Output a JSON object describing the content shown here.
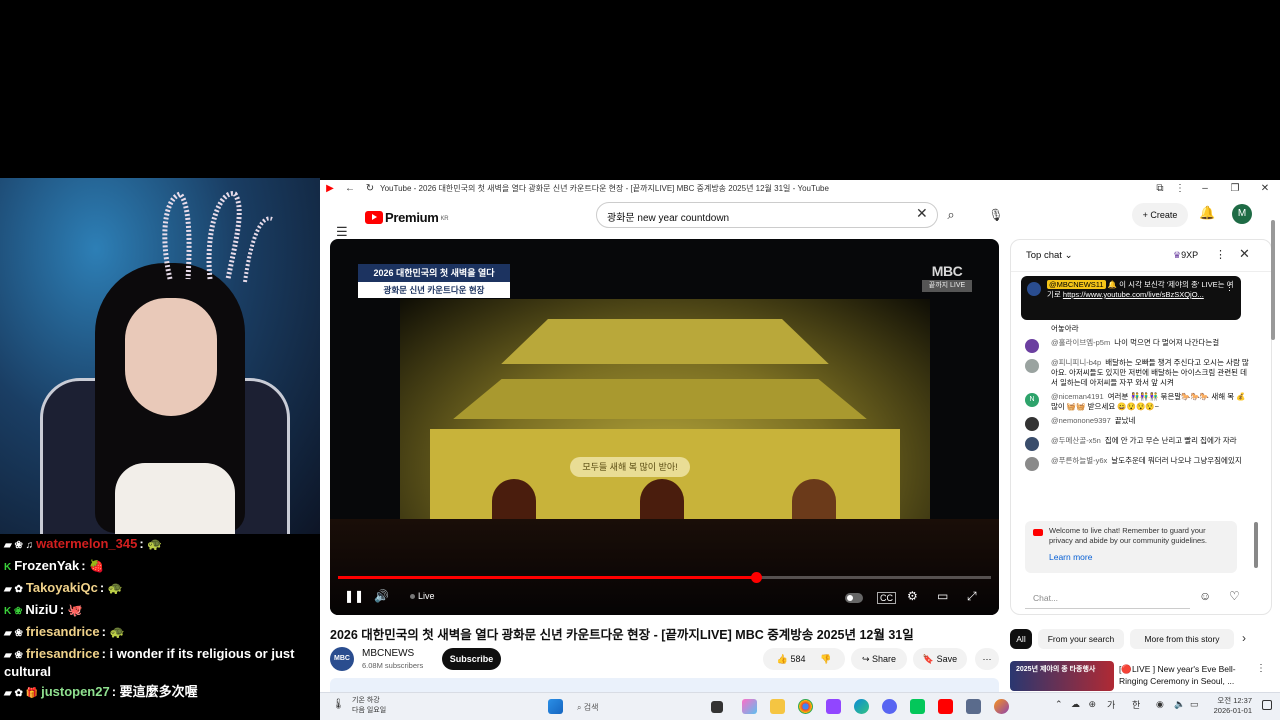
{
  "stream_chat": [
    {
      "badges": "▰ ❀ ♫",
      "user": "watermelon_345",
      "color": "#d21f1f",
      "sep": ":",
      "text": "",
      "emote": "🐢"
    },
    {
      "badges": "K",
      "user": "FrozenYak",
      "color": "#ffffff",
      "sep": ":",
      "text": "",
      "emote": "🍓"
    },
    {
      "badges": "▰ ✿",
      "user": "TakoyakiQc",
      "color": "#f0d28a",
      "sep": ":",
      "text": "",
      "emote": "🐢"
    },
    {
      "badges": "K ❀",
      "user": "NiziU",
      "color": "#ffffff",
      "sep": ":",
      "text": "",
      "emote": "🐙"
    },
    {
      "badges": "▰ ❀",
      "user": "friesandrice",
      "color": "#f0d28a",
      "sep": ":",
      "text": "",
      "emote": "🐢"
    },
    {
      "badges": "▰ ❀",
      "user": "friesandrice",
      "color": "#f0d28a",
      "sep": ":",
      "text": "i wonder if its religious or just cultural",
      "emote": ""
    },
    {
      "badges": "▰ ✿ 🎁",
      "user": "justopen27",
      "color": "#8fe08f",
      "sep": ":",
      "text": "要這麼多次喔",
      "emote": ""
    }
  ],
  "browser": {
    "window_title": "YouTube - 2026 대한민국의 첫 새벽을 열다 광화문 신년 카운트다운 현장 - [끝까지LIVE] MBC 중계방송 2025년 12월 31일 - YouTube",
    "brand": "Premium",
    "brand_region": "KR",
    "search_value": "광화문 new year countdown",
    "create_label": "Create",
    "avatar_letter": "M"
  },
  "player": {
    "caption_line1": "2026 대한민국의 첫 새벽을 열다",
    "caption_line2": "광화문 신년 카운트다운 현장",
    "logo": "MBC",
    "logo_sub": "끝까지 LIVE",
    "banner_text": "모두들 새해 복 많이 받아!",
    "live_label": "Live",
    "progress": 0.64
  },
  "video": {
    "title": "2026 대한민국의 첫 새벽을 열다 광화문 신년 카운트다운 현장 - [끝까지LIVE] MBC 중계방송 2025년 12월 31일",
    "channel": "MBCNEWS",
    "channel_avatar": "MBC NEWS",
    "subscribers": "6.08M subscribers",
    "subscribe_label": "Subscribe",
    "likes": "584",
    "share_label": "Share",
    "save_label": "Save"
  },
  "live_chat": {
    "header": "Top chat",
    "xp": "9XP",
    "pinned": {
      "tag": "@MBCNEWS11",
      "text": "🔔 이 시각 보신각 '제야의 종' LIVE는 여기로",
      "link": "https://www.youtube.com/live/sBzSXQjO..."
    },
    "messages": [
      {
        "author": "",
        "text": "어놓아라",
        "av_color": "#ffffff",
        "av_letter": ""
      },
      {
        "author": "@홀라이브엠-p5m",
        "text": "나이 먹으면 다 멀어져 나간다는걸",
        "av_color": "#6b3fa0",
        "av_letter": ""
      },
      {
        "author": "@피니피니-b4p",
        "text": "배달하는 오빠들 챙겨 주신다고 오시는 사람 많아요. 아저씨들도 있지만 저번에 배달하는 아이스크림 관련된 데서 일하는데 아저씨들 자꾸 와서 앞 시켜",
        "av_color": "#9aa3a0",
        "av_letter": ""
      },
      {
        "author": "@niceman4191",
        "text": "여러분 👫👫👫 묶은말🐎🐎🐎 새해 복 💰 많이 🧺🧺 받으세요 😀😯😯😯~",
        "av_color": "#2ea36b",
        "av_letter": "N"
      },
      {
        "author": "@nemonone9397",
        "text": "끝났네",
        "av_color": "#333333",
        "av_letter": ""
      },
      {
        "author": "@두메산골-x5n",
        "text": "집에 안 가고 무슨 난리고 빨리 집에가 자라",
        "av_color": "#3a4d6b",
        "av_letter": ""
      },
      {
        "author": "@푸른하늘별-y6x",
        "text": "날도추운데 뭐더러 나오냐 그냥우짐에있지",
        "av_color": "#8a8a8a",
        "av_letter": ""
      }
    ],
    "welcome": "Welcome to live chat! Remember to guard your privacy and abide by our community guidelines.",
    "learn_more": "Learn more",
    "input_placeholder": "Chat..."
  },
  "chips": [
    "All",
    "From your search",
    "More from this story"
  ],
  "recommended": {
    "title": "[🔴LIVE ] New year's Eve Bell-Ringing Ceremony in Seoul, ...",
    "thumb_text": "2025년 제야의 종 타종행사"
  },
  "taskbar": {
    "weather_temp": "기온 하강",
    "weather_sub": "다음 일요일",
    "search_label": "검색",
    "ime_1": "가",
    "ime_2": "한",
    "time": "오전 12:37",
    "date": "2026-01-01"
  }
}
